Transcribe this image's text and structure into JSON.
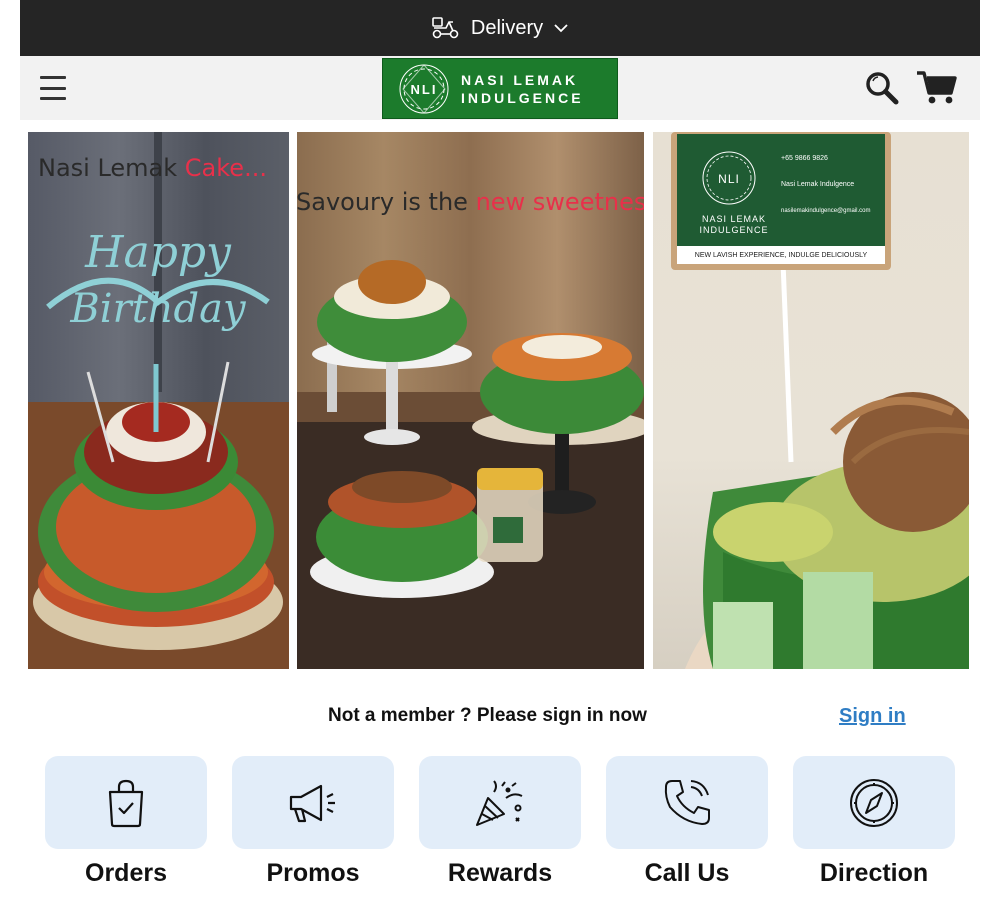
{
  "topbar": {
    "delivery_label": "Delivery",
    "icon": "scooter-icon"
  },
  "header": {
    "menu_icon": "hamburger-menu-icon",
    "logo": {
      "mark": "NLI",
      "line1": "NASI LEMAK",
      "line2": "INDULGENCE"
    },
    "search_icon": "search-icon",
    "cart_icon": "cart-icon"
  },
  "carousel": {
    "slides": [
      {
        "caption": "Nasi Lemak ",
        "caption_accent": "Cake...",
        "topper_text": "Happy Birthday"
      },
      {
        "caption": "Savoury is the ",
        "caption_accent": "new sweetness..."
      },
      {
        "card_mark": "NLI",
        "card_brand_1": "NASI LEMAK",
        "card_brand_2": "INDULGENCE",
        "phone": "+65 9866 9826",
        "facebook": "Nasi Lemak Indulgence",
        "email": "nasilemakindulgence@gmail.com",
        "tagline": "NEW LAVISH EXPERIENCE, INDULGE DELICIOUSLY"
      }
    ],
    "dots_total": 6,
    "active_dot": 1
  },
  "member": {
    "prompt": "Not a member ? Please sign in now",
    "signin_label": "Sign in"
  },
  "quick_links": [
    {
      "label": "Orders",
      "icon": "shopping-bag-icon"
    },
    {
      "label": "Promos",
      "icon": "megaphone-icon"
    },
    {
      "label": "Rewards",
      "icon": "party-popper-icon"
    },
    {
      "label": "Call Us",
      "icon": "phone-icon"
    },
    {
      "label": "Direction",
      "icon": "compass-icon"
    }
  ],
  "colors": {
    "accent_red": "#e0254a",
    "link_blue": "#2f7dc4",
    "tile_bg": "#e2edf9",
    "logo_green": "#1c7b2c",
    "topbar_bg": "#252525"
  }
}
